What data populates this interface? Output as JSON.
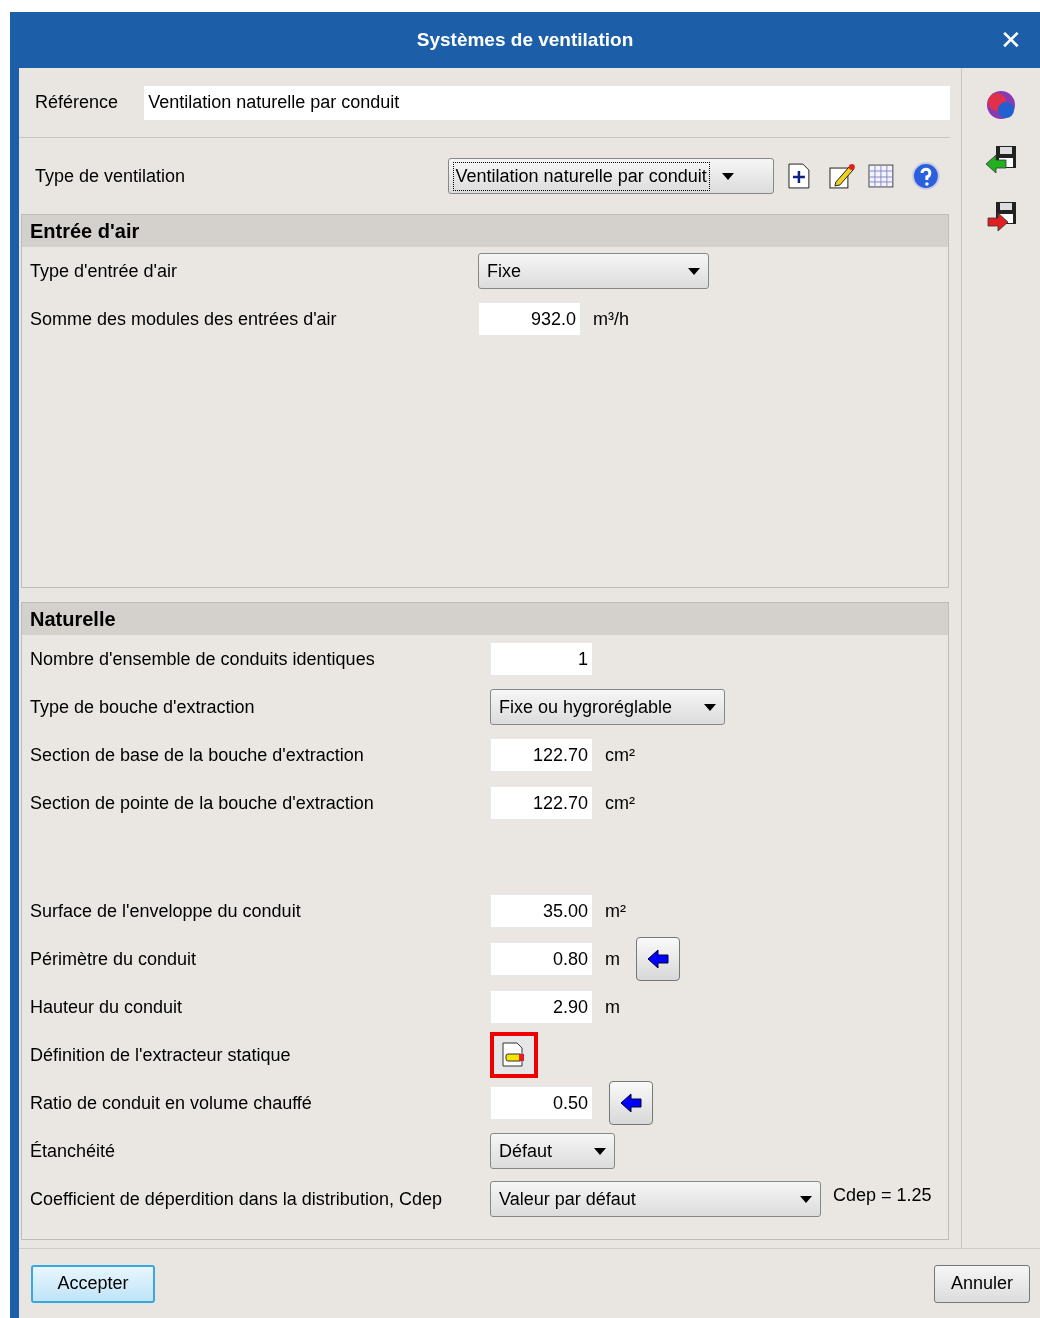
{
  "window": {
    "title": "Systèmes de ventilation",
    "close": "✕"
  },
  "reference": {
    "label": "Référence",
    "value": "Ventilation naturelle par conduit"
  },
  "ventilation_type": {
    "label": "Type de ventilation",
    "value": "Ventilation naturelle par conduit"
  },
  "entree_air": {
    "title": "Entrée d'air",
    "rows": [
      {
        "kind": "select",
        "label": "Type d'entrée d'air",
        "value": "Fixe"
      },
      {
        "kind": "number",
        "label": "Somme des modules des entrées d'air",
        "value": "932.0",
        "unit": "m³/h"
      }
    ]
  },
  "naturelle": {
    "title": "Naturelle",
    "groups": [
      [
        {
          "kind": "number",
          "label": "Nombre d'ensemble de conduits identiques",
          "value": "1"
        },
        {
          "kind": "select",
          "label": "Type de bouche d'extraction",
          "value": "Fixe ou hygroréglable"
        },
        {
          "kind": "number",
          "label": "Section de base de la bouche d'extraction",
          "value": "122.70",
          "unit": "cm²"
        },
        {
          "kind": "number",
          "label": "Section de pointe de la bouche d'extraction",
          "value": "122.70",
          "unit": "cm²"
        }
      ],
      [
        {
          "kind": "number",
          "label": "Surface de l'enveloppe du conduit",
          "value": "35.00",
          "unit": "m²"
        },
        {
          "kind": "number",
          "label": "Périmètre du conduit",
          "value": "0.80",
          "unit": "m",
          "arrow": true
        },
        {
          "kind": "number",
          "label": "Hauteur du conduit",
          "value": "2.90",
          "unit": "m"
        },
        {
          "kind": "extractor",
          "label": "Définition de l'extracteur statique",
          "highlighted": true
        },
        {
          "kind": "number",
          "label": "Ratio de conduit en volume chauffé",
          "value": "0.50",
          "arrow": true
        },
        {
          "kind": "select",
          "label": "Étanchéité",
          "value": "Défaut"
        },
        {
          "kind": "select",
          "label": "Coefficient de déperdition dans la distribution, Cdep",
          "value": "Valeur par défaut",
          "note": "Cdep = 1.25"
        }
      ]
    ]
  },
  "buttons": [
    {
      "label": "Accepter",
      "default": true
    },
    {
      "label": "Annuler",
      "default": false
    }
  ]
}
